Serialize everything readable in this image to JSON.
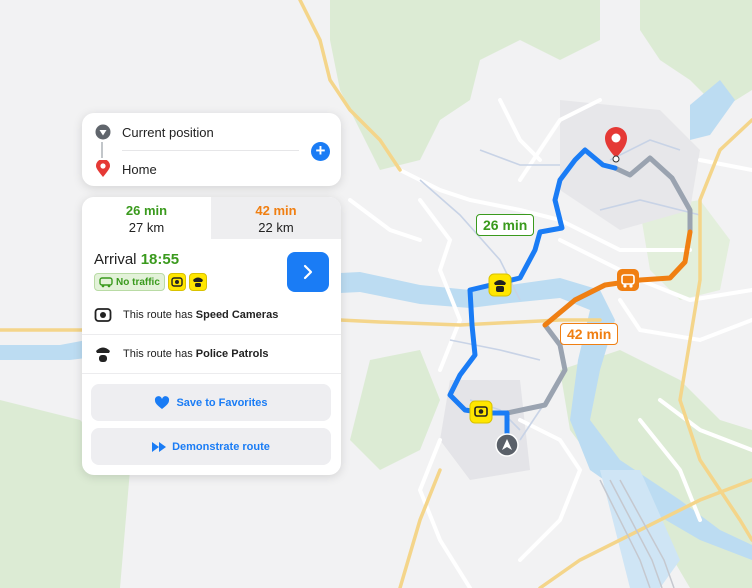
{
  "search": {
    "origin_label": "Current position",
    "destination_label": "Home"
  },
  "routes": {
    "tabs": [
      {
        "time": "26 min",
        "distance": "27 km",
        "color": "#3a9a1d",
        "selected": true
      },
      {
        "time": "42 min",
        "distance": "22 km",
        "color": "#f07f12",
        "selected": false
      }
    ]
  },
  "details": {
    "arrival_label": "Arrival",
    "arrival_time": "18:55",
    "traffic_badge": "No traffic",
    "speed_cameras": {
      "prefix": "This route has",
      "bold": "Speed Cameras"
    },
    "police_patrols": {
      "prefix": "This route has",
      "bold": "Police Patrols"
    }
  },
  "actions": {
    "save_label": "Save to Favorites",
    "demo_label": "Demonstrate route"
  },
  "map": {
    "fast_route_label": "26 min",
    "slow_route_label": "42 min",
    "colors": {
      "fast_route": "#1a7cf5",
      "slow_route": "#f07f12",
      "alt_route": "#9aa3b0",
      "river": "#bcdcf2",
      "forest": "#dcebd4",
      "major_road": "#f4d58a"
    },
    "icons": [
      "destination-pin-icon",
      "navigation-arrow-icon",
      "speed-camera-icon",
      "police-icon",
      "traffic-jam-icon"
    ]
  }
}
